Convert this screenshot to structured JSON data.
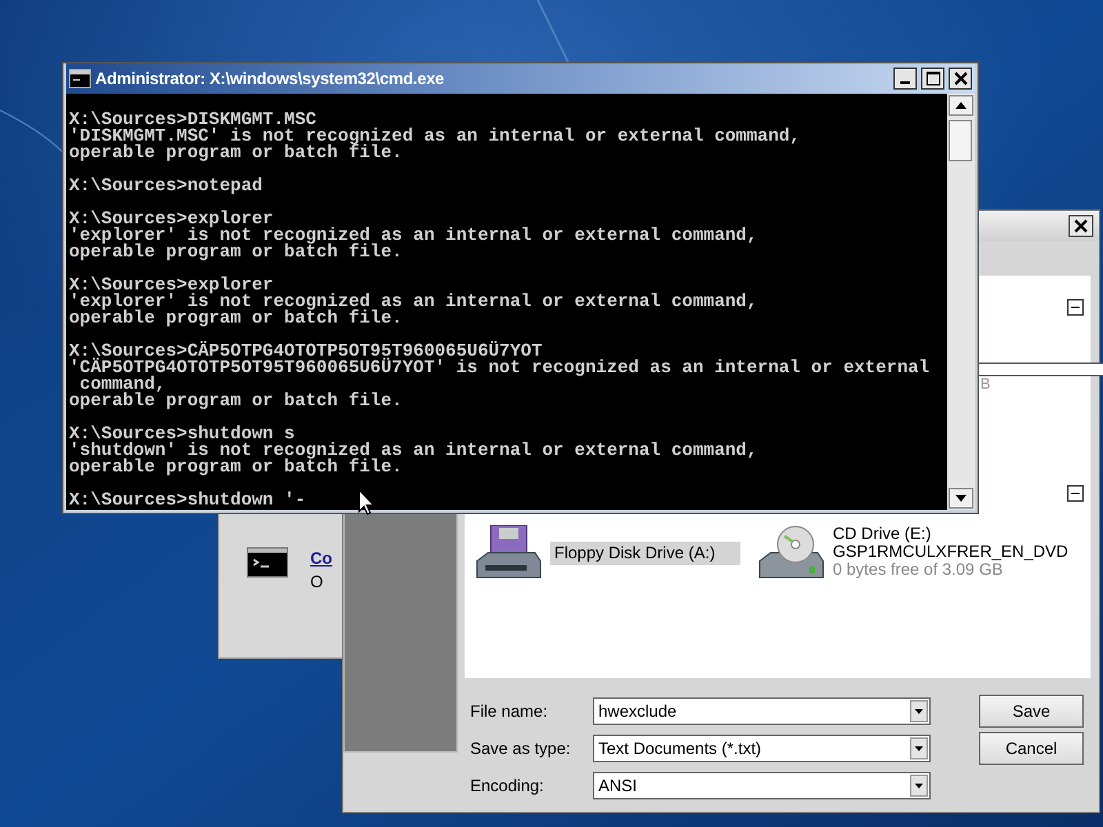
{
  "background_window": {
    "link": "Co",
    "text": "O"
  },
  "save_dialog": {
    "size_text": "B",
    "drives": [
      {
        "kind": "floppy",
        "name": "Floppy Disk Drive (A:)",
        "selected": true
      },
      {
        "kind": "cd",
        "name": "CD Drive (E:)",
        "label": "GSP1RMCULXFRER_EN_DVD",
        "free": "0 bytes free of 3.09 GB",
        "selected": false
      }
    ],
    "fields": [
      {
        "label": "File name:",
        "value": "hwexclude"
      },
      {
        "label": "Save as type:",
        "value": "Text Documents (*.txt)"
      },
      {
        "label": "Encoding:",
        "value": "ANSI"
      }
    ],
    "buttons": [
      "Save",
      "Cancel"
    ]
  },
  "console": {
    "title": "Administrator: X:\\windows\\system32\\cmd.exe",
    "blocks": [
      [
        "X:\\Sources>DISKMGMT.MSC",
        "'DISKMGMT.MSC' is not recognized as an internal or external command,",
        "operable program or batch file."
      ],
      [
        "X:\\Sources>notepad"
      ],
      [
        "X:\\Sources>explorer",
        "'explorer' is not recognized as an internal or external command,",
        "operable program or batch file."
      ],
      [
        "X:\\Sources>explorer",
        "'explorer' is not recognized as an internal or external command,",
        "operable program or batch file."
      ],
      [
        "X:\\Sources>CÄP5OTPG4OTOTP5OT95T960065U6Ü7YOT",
        "'CÄP5OTPG4OTOTP5OT95T960065U6Ü7YOT' is not recognized as an internal or external",
        " command,",
        "operable program or batch file."
      ],
      [
        "X:\\Sources>shutdown s",
        "'shutdown' is not recognized as an internal or external command,",
        "operable program or batch file."
      ],
      [
        "X:\\Sources>shutdown '-"
      ]
    ]
  }
}
